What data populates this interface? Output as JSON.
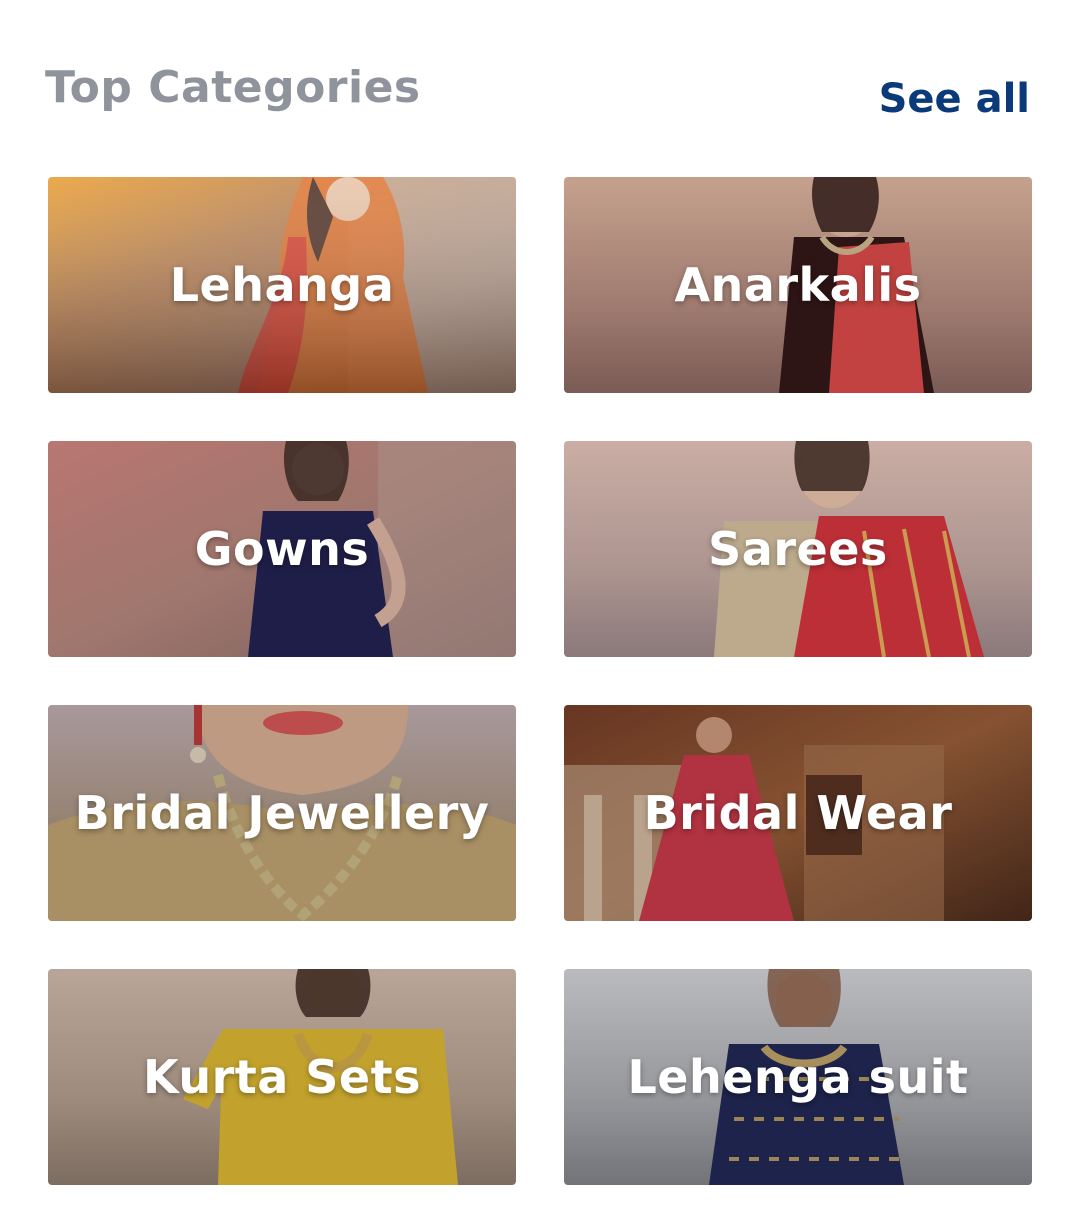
{
  "header": {
    "title": "Top Categories",
    "see_all_label": "See all"
  },
  "colors": {
    "title": "#8e939c",
    "link": "#0b3a7a",
    "label": "#ffffff"
  },
  "categories": [
    {
      "label": "Lehanga"
    },
    {
      "label": "Anarkalis"
    },
    {
      "label": "Gowns"
    },
    {
      "label": "Sarees"
    },
    {
      "label": "Bridal Jewellery"
    },
    {
      "label": "Bridal Wear"
    },
    {
      "label": "Kurta Sets"
    },
    {
      "label": "Lehenga suit"
    }
  ]
}
